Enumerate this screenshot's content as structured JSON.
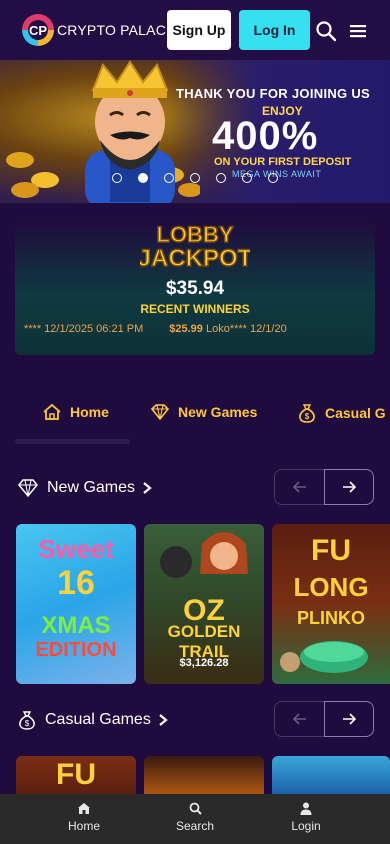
{
  "header": {
    "logo_mark": "CP",
    "logo_word1": "CRYPTO",
    "logo_word2": "PALACE",
    "signup_label": "Sign Up",
    "login_label": "Log In"
  },
  "banner": {
    "line1": "THANK YOU FOR JOINING US",
    "line2": "ENJOY",
    "line3": "400%",
    "line4": "ON YOUR FIRST DEPOSIT",
    "line5": "MEGA WINS AWAIT",
    "slides": 7,
    "active_slide": 2
  },
  "jackpot": {
    "title_line1": "LOBBY",
    "title_line2": "JACKPOT",
    "amount": "$35.94",
    "recent_label": "RECENT WINNERS",
    "winners": [
      {
        "text": "**** 12/1/2025 06:21 PM"
      },
      {
        "amount": "$25.99",
        "text": " Loko**** 12/1/20"
      }
    ]
  },
  "categories": [
    {
      "label": "Home"
    },
    {
      "label": "New Games"
    },
    {
      "label": "Casual G"
    }
  ],
  "sections": {
    "new_games": {
      "title": "New Games",
      "games": [
        {
          "lines": [
            "Sweet",
            "16",
            "XMAS",
            "EDITION"
          ]
        },
        {
          "lines": [
            "OZ",
            "GOLDEN TRAIL"
          ],
          "jackpot": "$3,126.28"
        },
        {
          "lines": [
            "FU",
            "LONG",
            "PLINKO"
          ]
        }
      ]
    },
    "casual_games": {
      "title": "Casual Games",
      "games": [
        {
          "lines": [
            "FU"
          ]
        },
        {
          "lines": []
        },
        {
          "lines": []
        }
      ]
    }
  },
  "bottom_nav": {
    "home": "Home",
    "search": "Search",
    "login": "Login"
  },
  "colors": {
    "background": "#1f0b3d",
    "accent_cyan": "#35e0f0",
    "gold": "#ffc83a"
  }
}
